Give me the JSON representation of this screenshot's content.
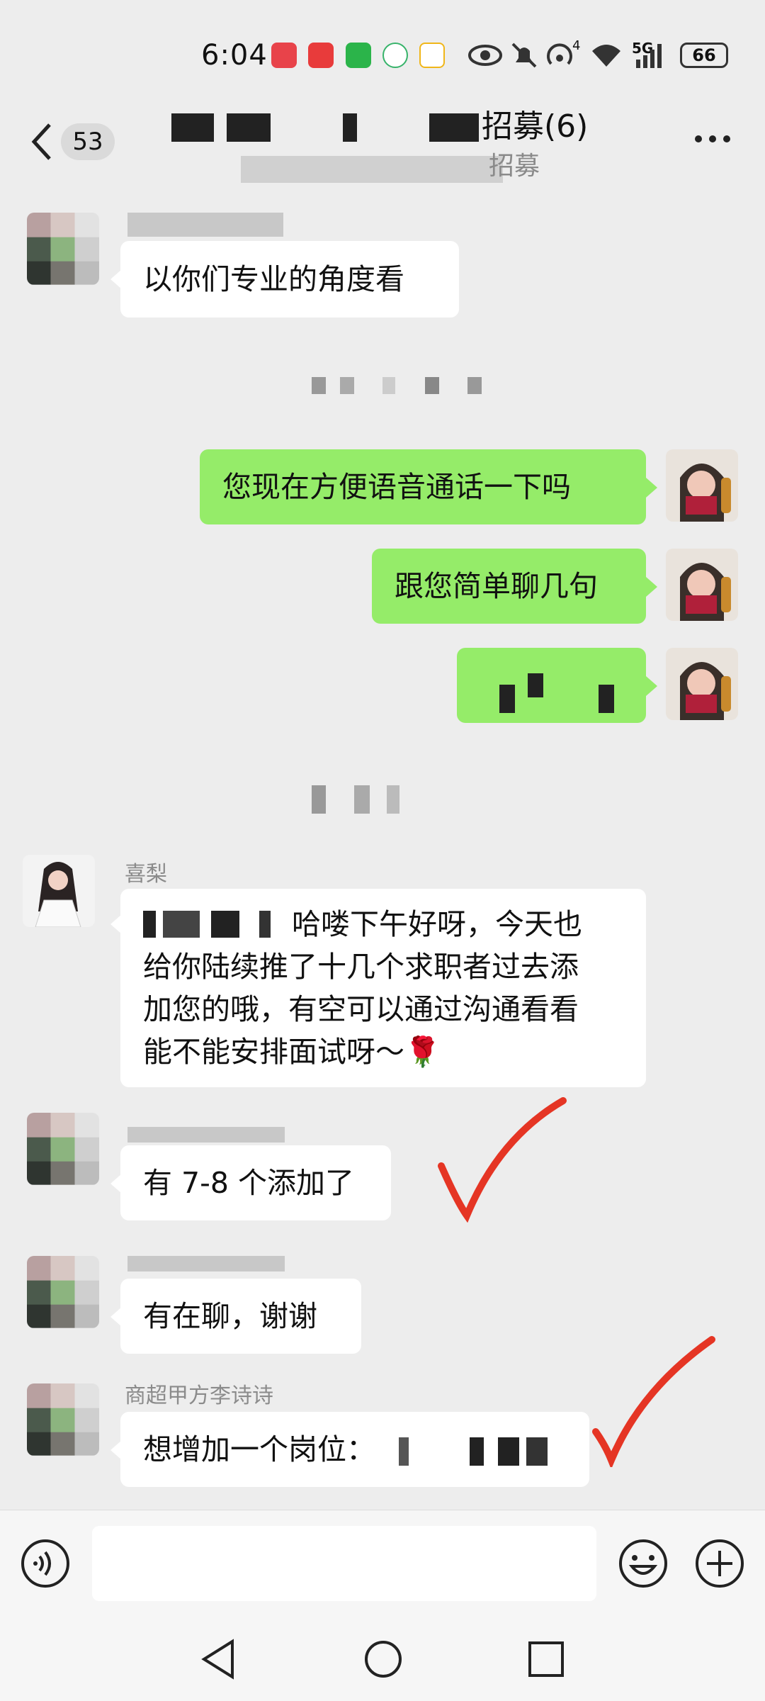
{
  "status_bar": {
    "time": "6:04",
    "network": "5G",
    "battery": "66",
    "wifi_badge": "4"
  },
  "header": {
    "unread_count": "53",
    "title": "招募(6)",
    "subtitle": "招募",
    "more_icon": "more-icon"
  },
  "messages": [
    {
      "side": "left",
      "text": "以你们专业的角度看"
    },
    {
      "side": "right",
      "text": "您现在方便语音通话一下吗"
    },
    {
      "side": "right",
      "text": "跟您简单聊几句"
    },
    {
      "side": "left",
      "sender": "喜梨",
      "lines": [
        "哈喽下午好呀，今天也",
        "给你陆续推了十几个求职者过去添",
        "加您的哦，有空可以通过沟通看看",
        "能不能安排面试呀～🌹"
      ]
    },
    {
      "side": "left",
      "text": "有 7-8 个添加了"
    },
    {
      "side": "left",
      "text": "有在聊，谢谢"
    },
    {
      "side": "left",
      "sender": "商超甲方李诗诗",
      "text": "想增加一个岗位："
    }
  ],
  "input_bar": {
    "voice_icon": "voice-icon",
    "emoji_icon": "emoji-icon",
    "plus_icon": "plus-icon"
  },
  "colors": {
    "background": "#ededed",
    "bubble_self": "#95ec69",
    "bubble_other": "#ffffff",
    "check_mark": "#e53524"
  }
}
